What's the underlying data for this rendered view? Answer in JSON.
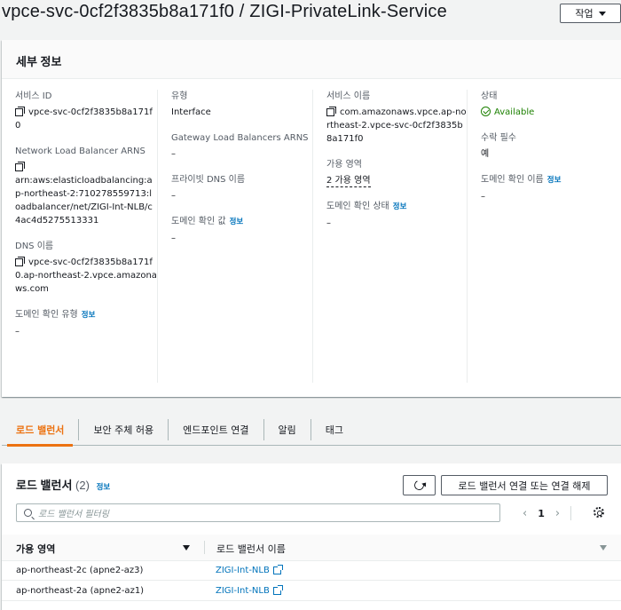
{
  "page": {
    "title": "vpce-svc-0cf2f3835b8a171f0 / ZIGI-PrivateLink-Service",
    "actions_label": "작업"
  },
  "details": {
    "header": "세부 정보",
    "info": "정보",
    "service_id": {
      "label": "서비스 ID",
      "value": "vpce-svc-0cf2f3835b8a171f0"
    },
    "nlb_arns": {
      "label": "Network Load Balancer ARNS",
      "value": "arn:aws:elasticloadbalancing:ap-northeast-2:710278559713:loadbalancer/net/ZIGI-Int-NLB/c4ac4d5275513331"
    },
    "dns_name": {
      "label": "DNS 이름",
      "value": "vpce-svc-0cf2f3835b8a171f0.ap-northeast-2.vpce.amazonaws.com"
    },
    "domain_verify_type": {
      "label": "도메인 확인 유형",
      "value": "–"
    },
    "type": {
      "label": "유형",
      "value": "Interface"
    },
    "gwlb_arns": {
      "label": "Gateway Load Balancers ARNS",
      "value": "–"
    },
    "private_dns": {
      "label": "프라이빗 DNS 이름",
      "value": "–"
    },
    "domain_verify_value": {
      "label": "도메인 확인 값",
      "value": "–"
    },
    "service_name": {
      "label": "서비스 이름",
      "value": "com.amazonaws.vpce.ap-northeast-2.vpce-svc-0cf2f3835b8a171f0"
    },
    "availability_zones": {
      "label": "가용 영역",
      "value": "2 가용 영역"
    },
    "domain_verify_status": {
      "label": "도메인 확인 상태",
      "value": "–"
    },
    "status": {
      "label": "상태",
      "value": "Available"
    },
    "acceptance_required": {
      "label": "수락 필수",
      "value": "예"
    },
    "domain_verify_name": {
      "label": "도메인 확인 이름",
      "value": "–"
    }
  },
  "tabs": [
    {
      "label": "로드 밸런서"
    },
    {
      "label": "보안 주체 허용"
    },
    {
      "label": "엔드포인트 연결"
    },
    {
      "label": "알림"
    },
    {
      "label": "태그"
    }
  ],
  "load_balancers": {
    "title": "로드 밸런서",
    "count": "(2)",
    "info": "정보",
    "assoc_button": "로드 밸런서 연결 또는 연결 해제",
    "search_placeholder": "로드 밸런서 필터링",
    "page": "1",
    "columns": [
      "가용 영역",
      "로드 밸런서 이름"
    ],
    "rows": [
      {
        "az": "ap-northeast-2c (apne2-az3)",
        "name": "ZIGI-Int-NLB"
      },
      {
        "az": "ap-northeast-2a (apne2-az1)",
        "name": "ZIGI-Int-NLB"
      }
    ]
  }
}
